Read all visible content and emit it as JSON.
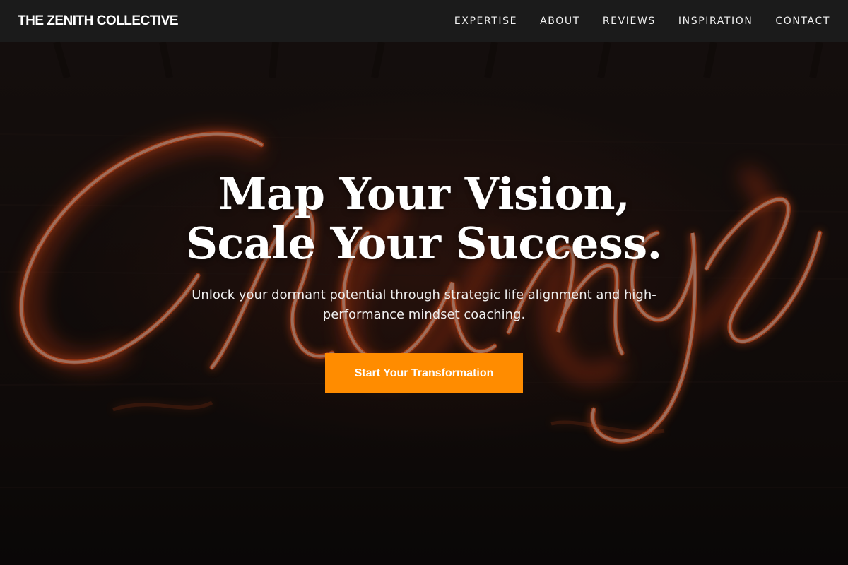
{
  "brand": {
    "name": "THE ZENITH COLLECTIVE"
  },
  "nav": {
    "items": [
      {
        "label": "EXPERTISE"
      },
      {
        "label": "ABOUT"
      },
      {
        "label": "REVIEWS"
      },
      {
        "label": "INSPIRATION"
      },
      {
        "label": "CONTACT"
      }
    ]
  },
  "hero": {
    "headline_line1": "Map Your Vision,",
    "headline_line2": "Scale Your Success.",
    "subtext": "Unlock your dormant potential through strategic life alignment and high-performance mindset coaching.",
    "cta_label": "Start Your Transformation",
    "background_image": "neon-change-sign"
  },
  "colors": {
    "navbar_bg": "#1c1c1c",
    "accent": "#ff8c00",
    "text": "#ffffff",
    "neon_orange": "#ff5a1f",
    "neon_pink": "#f6b8a6"
  }
}
